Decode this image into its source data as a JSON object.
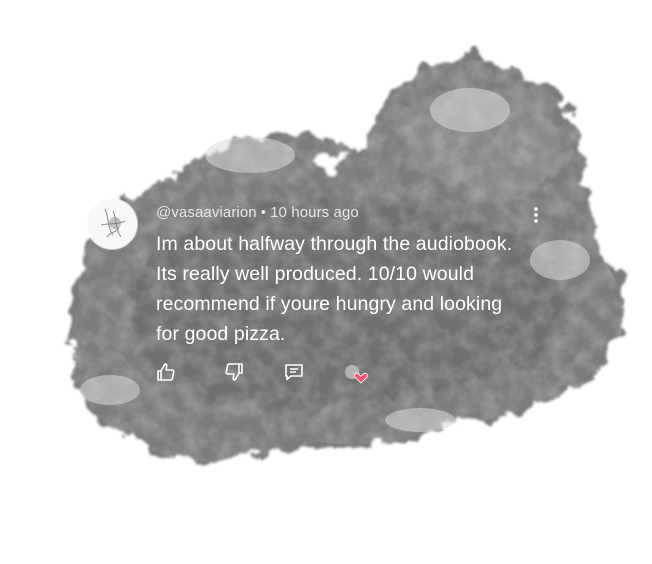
{
  "comment": {
    "author": "@vasaaviarion",
    "separator": "•",
    "time": "10 hours ago",
    "text_lines": [
      "Im about halfway through the audiobook.",
      "Its really well produced. 10/10 would",
      "recommend if youre hungry and looking",
      "for good pizza."
    ]
  },
  "icons": {
    "avatar": "avatar-image",
    "more": "more-vertical-icon",
    "like": "thumbs-up-icon",
    "dislike": "thumbs-down-icon",
    "reply": "reply-comment-icon",
    "creator_heart": "creator-heart-icon"
  },
  "colors": {
    "smoke_dark": "#6a6a6a",
    "smoke_mid": "#8c8c8c",
    "text": "#ffffff",
    "meta": "#e6e6e6",
    "heart": "#ff4f6d"
  }
}
